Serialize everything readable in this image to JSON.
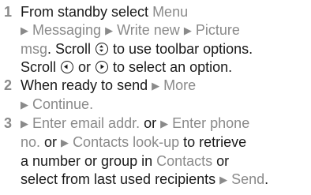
{
  "steps": [
    {
      "number": "1",
      "lines": {
        "l1_text": "From standby select ",
        "l1_menu": "Menu",
        "l2_messaging": "Messaging",
        "l2_write_new": "Write new",
        "l2_picture": "Picture",
        "l3_msg": "msg",
        "l3_text_a": ". Scroll ",
        "l3_text_b": " to use toolbar options.",
        "l4_text_a": "Scroll ",
        "l4_text_or": " or ",
        "l4_text_b": " to select an option."
      }
    },
    {
      "number": "2",
      "lines": {
        "l1_text": "When ready to send ",
        "l1_more": "More",
        "l2_continue": "Continue."
      }
    },
    {
      "number": "3",
      "lines": {
        "l1_enter_email": "Enter email addr.",
        "l1_or": " or ",
        "l1_enter_phone": "Enter phone",
        "l2_no": "no.",
        "l2_or": " or ",
        "l2_contacts_lookup": "Contacts look-up",
        "l2_text": " to retrieve",
        "l3_text_a": "a number or group in ",
        "l3_contacts": "Contacts",
        "l3_text_b": " or",
        "l4_text": "select from last used recipients ",
        "l4_send": "Send"
      }
    }
  ],
  "icons": {
    "arrow": "right-triangle-icon",
    "nav_updown": "nav-key-up-down-icon",
    "nav_left": "nav-key-left-icon",
    "nav_right": "nav-key-right-icon"
  },
  "colors": {
    "text": "#1a1a1a",
    "highlight": "#8a8a8a"
  }
}
